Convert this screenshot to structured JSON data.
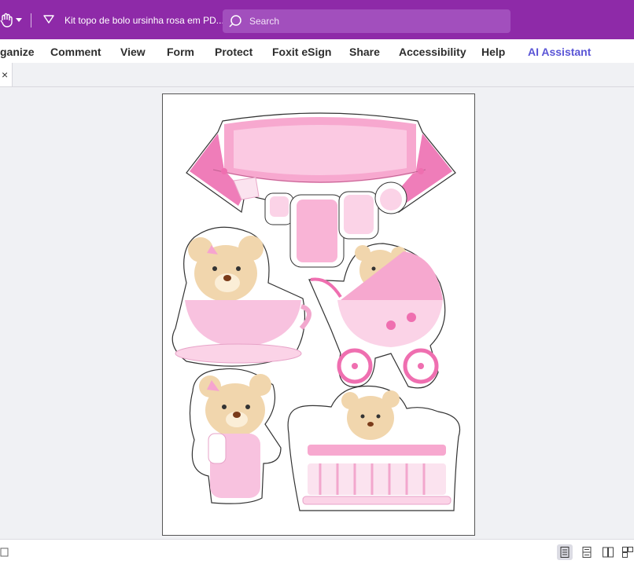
{
  "titlebar": {
    "document_title": "Kit topo de bolo ursinha rosa em PD...",
    "search_placeholder": "Search",
    "accent_color": "#8e2aa8"
  },
  "menu": {
    "items": [
      "ganize",
      "Comment",
      "View",
      "Form",
      "Protect",
      "Foxit eSign",
      "Share",
      "Accessibility",
      "Help",
      "AI Assistant"
    ]
  },
  "tabs": {
    "close_glyph": "×"
  },
  "document": {
    "illustrations": [
      "banner-with-clothesline",
      "bear-in-teacup",
      "bear-in-stroller",
      "bear-with-bottle",
      "bear-in-crib"
    ],
    "palette": {
      "pink": "#f7a8cf",
      "light_pink": "#fbd3e7",
      "deep_pink": "#ef6fb0",
      "bear": "#f1d6ad"
    }
  },
  "statusbar": {
    "view_modes": [
      "single-page-icon",
      "continuous-icon",
      "two-page-icon",
      "two-page-continuous-icon"
    ],
    "active_view": "single-page-icon"
  }
}
